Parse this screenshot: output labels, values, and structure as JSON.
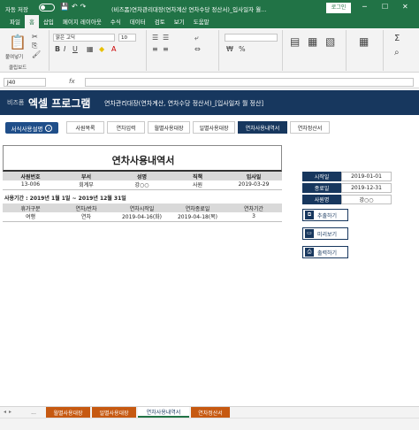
{
  "titlebar": {
    "autosave": "자동 저장",
    "doc_title": "(비즈폼)연차관리대장(연차계산 연차수당 정산서)_입사일자 월...",
    "login": "로그인"
  },
  "tabs": [
    "파일",
    "홈",
    "삽입",
    "페이지 레이아웃",
    "수식",
    "데이터",
    "검토",
    "보기",
    "도움말"
  ],
  "active_tab": "홈",
  "ribbon": {
    "paste": "붙여넣기",
    "clipboard": "클립보드",
    "font_name": "맑은 고딕",
    "font_size": "10"
  },
  "formula_bar": {
    "name_box": "J40",
    "fx": "fx"
  },
  "header": {
    "brand": "비즈폼",
    "program": "엑셀 프로그램",
    "desc": "연차관리대장(연차계산, 연차수당 정산서)_[입사일자 월 정산]"
  },
  "guide_button": "서식사용설명",
  "nav_buttons": [
    "사원목록",
    "연차입력",
    "월별사용대장",
    "일별사용대장",
    "연차사용내역서",
    "연차정산서"
  ],
  "nav_active": "연차사용내역서",
  "report_title": "연차사용내역서",
  "employee": {
    "headers": [
      "사원번호",
      "부서",
      "성명",
      "직책",
      "입사일"
    ],
    "values": [
      "13-006",
      "회계부",
      "강○○",
      "사원",
      "2019-03-29"
    ]
  },
  "period": "사용기간 : 2019년 1월 1일 ~ 2019년 12월 31일",
  "usage": {
    "headers": [
      "휴가구분",
      "연차/반차",
      "연차시작일",
      "연차종료일",
      "연차기간"
    ],
    "rows": [
      [
        "여행",
        "연차",
        "2019-04-16(화)",
        "2019-04-18(목)",
        "3"
      ]
    ]
  },
  "side_info": [
    {
      "k": "시작일",
      "v": "2019-01-01"
    },
    {
      "k": "종료일",
      "v": "2019-12-31"
    },
    {
      "k": "사원명",
      "v": "강○○"
    }
  ],
  "actions": [
    "추출하기",
    "미리보기",
    "출력하기"
  ],
  "sheet_tabs": [
    "...",
    "월별사용대장",
    "일별사용대장",
    "연차사용내역서",
    "연차정산서"
  ],
  "active_sheet": "연차사용내역서"
}
